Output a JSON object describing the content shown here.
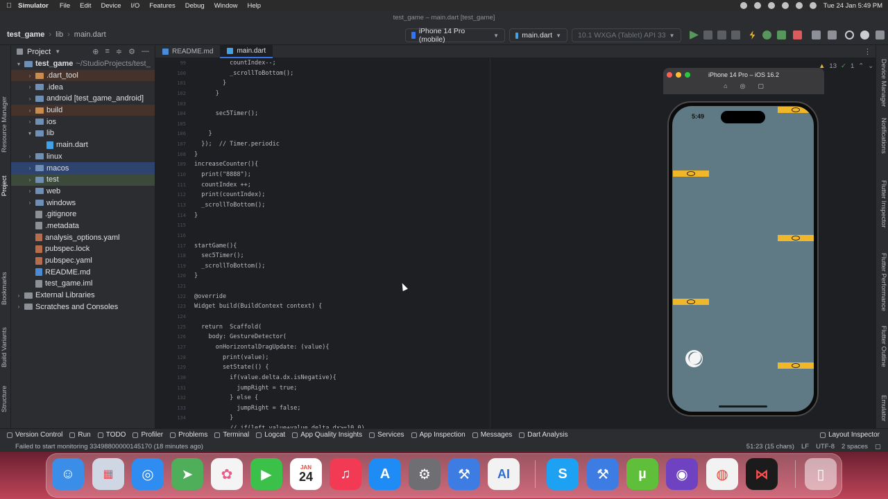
{
  "mac_menu": {
    "app": "Simulator",
    "items": [
      "File",
      "Edit",
      "Device",
      "I/O",
      "Features",
      "Debug",
      "Window",
      "Help"
    ],
    "clock": "Tue 24 Jan  5:49 PM"
  },
  "window_title": "test_game – main.dart [test_game]",
  "breadcrumb": {
    "project": "test_game",
    "folder": "lib",
    "file": "main.dart"
  },
  "toolbar": {
    "device": "iPhone 14 Pro (mobile)",
    "config": "main.dart",
    "target": "10.1  WXGA (Tablet) API 33"
  },
  "project_panel": {
    "title": "Project",
    "tree": [
      {
        "label": "test_game",
        "extra": "~/StudioProjects/test_",
        "depth": 0,
        "kind": "folder",
        "open": true,
        "bold": true
      },
      {
        "label": ".dart_tool",
        "depth": 1,
        "kind": "folder",
        "open": false,
        "hl": "orange"
      },
      {
        "label": ".idea",
        "depth": 1,
        "kind": "folder",
        "open": false
      },
      {
        "label": "android [test_game_android]",
        "depth": 1,
        "kind": "folder",
        "open": false
      },
      {
        "label": "build",
        "depth": 1,
        "kind": "folder",
        "open": false,
        "hl": "orange"
      },
      {
        "label": "ios",
        "depth": 1,
        "kind": "folder",
        "open": false
      },
      {
        "label": "lib",
        "depth": 1,
        "kind": "folder",
        "open": true
      },
      {
        "label": "main.dart",
        "depth": 2,
        "kind": "file"
      },
      {
        "label": "linux",
        "depth": 1,
        "kind": "folder",
        "open": false
      },
      {
        "label": "macos",
        "depth": 1,
        "kind": "folder",
        "open": false,
        "hl": "sel"
      },
      {
        "label": "test",
        "depth": 1,
        "kind": "folder",
        "open": false,
        "hl": "green"
      },
      {
        "label": "web",
        "depth": 1,
        "kind": "folder",
        "open": false
      },
      {
        "label": "windows",
        "depth": 1,
        "kind": "folder",
        "open": false
      },
      {
        "label": ".gitignore",
        "depth": 1,
        "kind": "file"
      },
      {
        "label": ".metadata",
        "depth": 1,
        "kind": "file"
      },
      {
        "label": "analysis_options.yaml",
        "depth": 1,
        "kind": "file"
      },
      {
        "label": "pubspec.lock",
        "depth": 1,
        "kind": "file"
      },
      {
        "label": "pubspec.yaml",
        "depth": 1,
        "kind": "file"
      },
      {
        "label": "README.md",
        "depth": 1,
        "kind": "file"
      },
      {
        "label": "test_game.iml",
        "depth": 1,
        "kind": "file"
      },
      {
        "label": "External Libraries",
        "depth": 0,
        "kind": "lib",
        "open": false
      },
      {
        "label": "Scratches and Consoles",
        "depth": 0,
        "kind": "lib",
        "open": false
      }
    ]
  },
  "left_tools": [
    "Resource Manager",
    "Project",
    "Bookmarks",
    "Build Variants",
    "Structure"
  ],
  "right_tools": [
    "Device Manager",
    "Notifications",
    "Flutter Inspector",
    "Flutter Performance",
    "Flutter Outline",
    "Emulator"
  ],
  "tabs": [
    {
      "label": "README.md",
      "active": false
    },
    {
      "label": "main.dart",
      "active": true
    }
  ],
  "inspections": {
    "warnings": "13",
    "ok": "1"
  },
  "line_numbers": [
    "99",
    "100",
    "101",
    "102",
    "103",
    "104",
    "105",
    "106",
    "107",
    "108",
    "109",
    "110",
    "111",
    "112",
    "113",
    "114",
    "115",
    "116",
    "117",
    "118",
    "119",
    "120",
    "121",
    "122",
    "123",
    "124",
    "125",
    "126",
    "127",
    "128",
    "129",
    "130",
    "131",
    "132",
    "133",
    "134"
  ],
  "code": [
    "          countIndex--;",
    "          _scrollToBottom();",
    "        }",
    "      }",
    "",
    "      sec5Timer();",
    "",
    "    }",
    "  });  // Timer.periodic",
    "}",
    "increaseCounter(){",
    "  print(\"8888\");",
    "  countIndex ++;",
    "  print(countIndex);",
    "  _scrollToBottom();",
    "}",
    "",
    "",
    "startGame(){",
    "  sec5Timer();",
    "  _scrollToBottom();",
    "}",
    "",
    "@override",
    "Widget build(BuildContext context) {",
    "",
    "  return  Scaffold(",
    "    body: GestureDetector(",
    "      onHorizontalDragUpdate: (value){",
    "        print(value);",
    "        setState(() {",
    "          if(value.delta.dx.isNegative){",
    "            jumpRight = true;",
    "          } else {",
    "            jumpRight = false;",
    "          }",
    "          // if(left_value+value.delta.dx>=10.0)"
  ],
  "simulator": {
    "title": "iPhone 14 Pro – iOS 16.2",
    "time": "5:49"
  },
  "bottom_tools": [
    "Version Control",
    "Run",
    "TODO",
    "Profiler",
    "Problems",
    "Terminal",
    "Logcat",
    "App Quality Insights",
    "Services",
    "App Inspection",
    "Messages",
    "Dart Analysis"
  ],
  "layout_inspector": "Layout Inspector",
  "status": {
    "message": "Failed to start monitoring 33498800000145170 (18 minutes ago)",
    "position": "51:23 (15 chars)",
    "lf": "LF",
    "encoding": "UTF-8",
    "indent": "2 spaces"
  },
  "dock": {
    "calendar_month": "JAN",
    "calendar_day": "24"
  },
  "colors": {
    "accent": "#3574f0",
    "phone_bg": "#5f7a85",
    "platform": "#f0b72a"
  }
}
